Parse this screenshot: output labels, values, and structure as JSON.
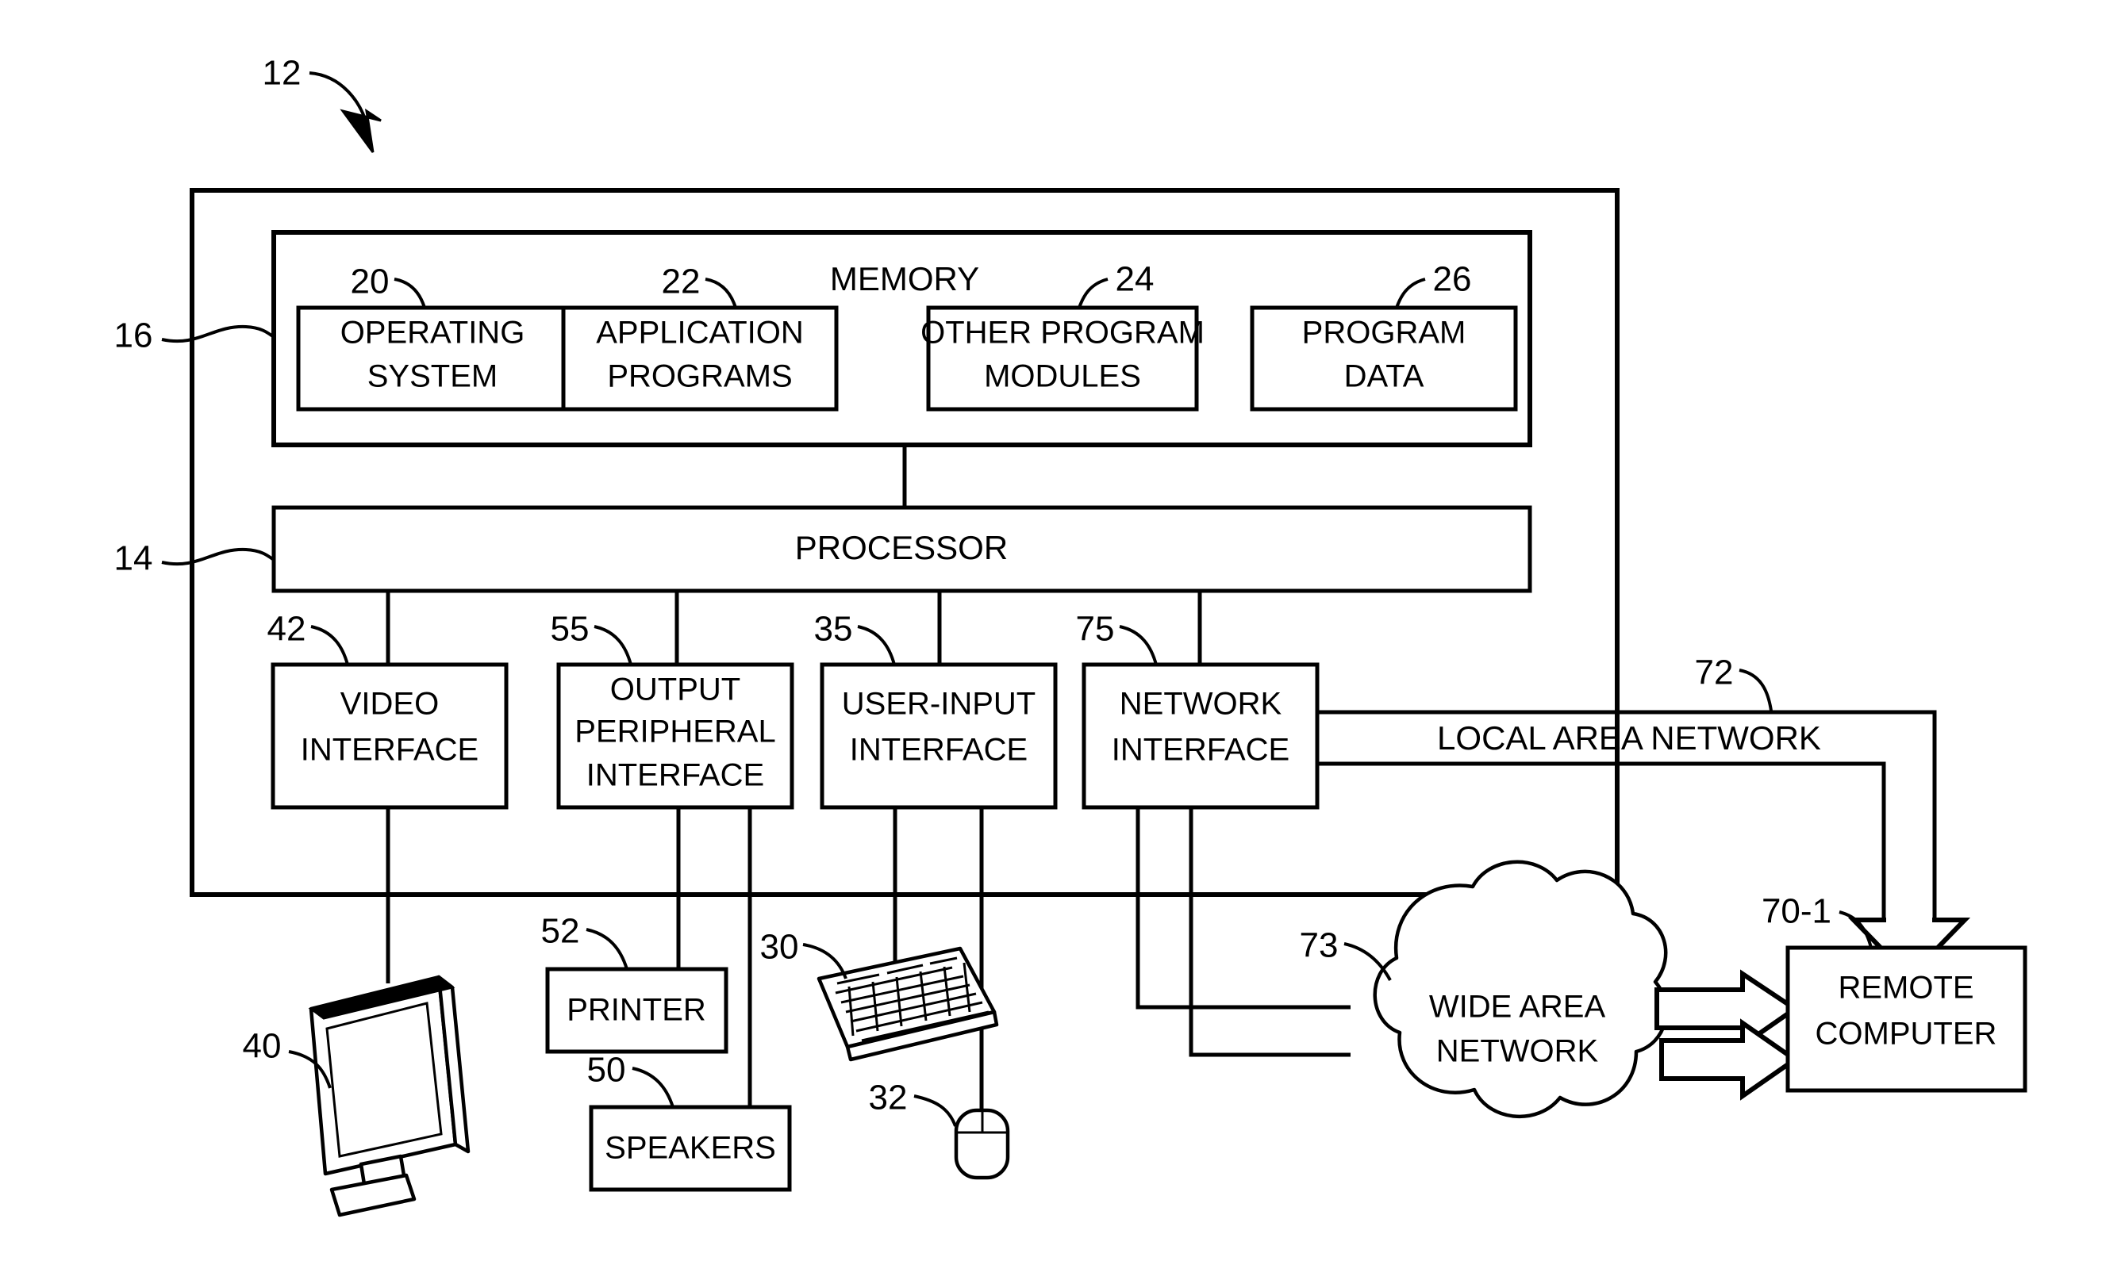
{
  "figure": {
    "title_ref": "12",
    "system_ref": "12"
  },
  "refs": {
    "system": "12",
    "memory": "16",
    "processor": "14",
    "operating_system": "20",
    "application_programs": "22",
    "other_program_modules": "24",
    "program_data": "26",
    "video_interface": "42",
    "output_peripheral_interface": "55",
    "user_input_interface": "35",
    "network_interface": "75",
    "local_area_network": "72",
    "wide_area_network": "73",
    "remote_computer": "70-1",
    "monitor": "40",
    "printer": "52",
    "speakers": "50",
    "keyboard": "30",
    "mouse": "32"
  },
  "memory": {
    "title": "MEMORY",
    "blocks": [
      {
        "ref": "20",
        "line1": "OPERATING",
        "line2": "SYSTEM"
      },
      {
        "ref": "22",
        "line1": "APPLICATION",
        "line2": "PROGRAMS"
      },
      {
        "ref": "24",
        "line1": "OTHER PROGRAM",
        "line2": "MODULES"
      },
      {
        "ref": "26",
        "line1": "PROGRAM",
        "line2": "DATA"
      }
    ]
  },
  "processor": {
    "label": "PROCESSOR",
    "ref": "14"
  },
  "interfaces": [
    {
      "ref": "42",
      "line1": "VIDEO",
      "line2": "INTERFACE",
      "line3": ""
    },
    {
      "ref": "55",
      "line1": "OUTPUT",
      "line2": "PERIPHERAL",
      "line3": "INTERFACE"
    },
    {
      "ref": "35",
      "line1": "USER-INPUT",
      "line2": "INTERFACE",
      "line3": ""
    },
    {
      "ref": "75",
      "line1": "NETWORK",
      "line2": "INTERFACE",
      "line3": ""
    }
  ],
  "peripherals": {
    "printer": "PRINTER",
    "speakers": "SPEAKERS",
    "monitor_ref": "40",
    "keyboard_ref": "30",
    "mouse_ref": "32"
  },
  "networks": {
    "lan_label": "LOCAL AREA NETWORK",
    "wan_line1": "WIDE AREA",
    "wan_line2": "NETWORK",
    "remote_line1": "REMOTE",
    "remote_line2": "COMPUTER"
  },
  "colors": {
    "ink": "#000000",
    "paper": "#ffffff"
  }
}
